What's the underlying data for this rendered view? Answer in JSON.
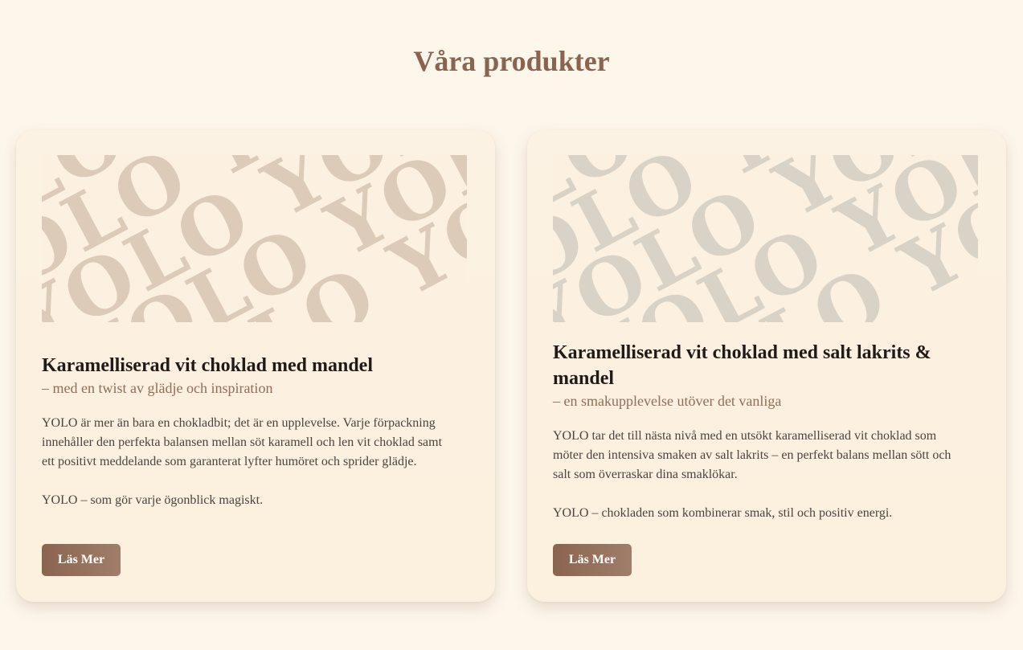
{
  "page": {
    "title": "Våra produkter"
  },
  "products": [
    {
      "image": {
        "pattern_text": "YOLO",
        "pattern_color": "#dccbb8"
      },
      "title": "Karamelliserad vit choklad med mandel",
      "subtitle": "– med en twist av glädje och inspiration",
      "description": "YOLO är mer än bara en chokladbit; det är en upplevelse. Varje förpackning innehåller den perfekta balansen mellan söt karamell och len vit choklad samt ett positivt meddelande som garanterat lyfter humöret och sprider glädje.",
      "tagline": "YOLO – som gör varje ögonblick magiskt.",
      "button_label": "Läs Mer"
    },
    {
      "image": {
        "pattern_text": "YOLO",
        "pattern_color": "#d9d2c6"
      },
      "title": "Karamelliserad vit choklad med salt lakrits & mandel",
      "subtitle": "– en smakupplevelse utöver det vanliga",
      "description": "YOLO tar det till nästa nivå med en utsökt karamelliserad vit choklad som möter den intensiva smaken av salt lakrits – en perfekt balans mellan sött och salt som överraskar dina smaklökar.",
      "tagline": "YOLO – chokladen som kombinerar smak, stil och positiv energi.",
      "button_label": "Läs Mer"
    }
  ],
  "colors": {
    "background": "#fdf6ea",
    "heading_accent": "#8b6450",
    "button_start": "#8b6450",
    "button_end": "#a07e69"
  }
}
